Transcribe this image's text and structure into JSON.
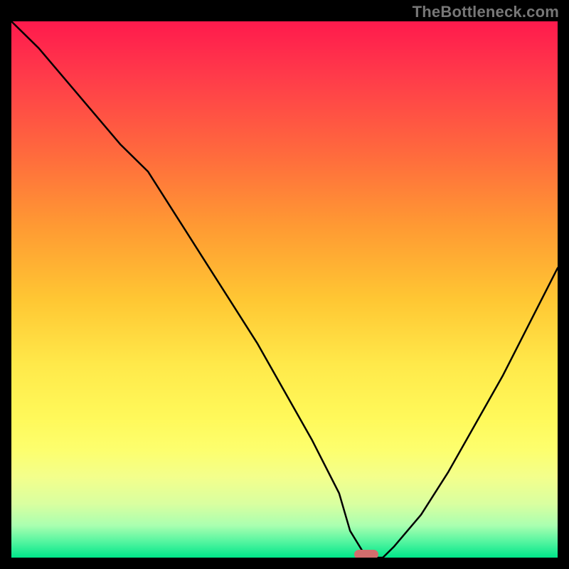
{
  "watermark": "TheBottleneck.com",
  "colors": {
    "background": "#000000",
    "curve": "#000000",
    "marker": "#d36d6d"
  },
  "chart_data": {
    "type": "line",
    "title": "",
    "xlabel": "",
    "ylabel": "",
    "xlim": [
      0,
      100
    ],
    "ylim": [
      0,
      100
    ],
    "grid": false,
    "legend": false,
    "annotations": [
      {
        "type": "marker",
        "x": 65,
        "y": 0,
        "shape": "pill"
      }
    ],
    "series": [
      {
        "name": "bottleneck-curve",
        "x": [
          0,
          5,
          10,
          15,
          20,
          25,
          30,
          35,
          40,
          45,
          50,
          55,
          60,
          62,
          65,
          68,
          70,
          75,
          80,
          85,
          90,
          95,
          100
        ],
        "y": [
          100,
          95,
          89,
          83,
          77,
          72,
          64,
          56,
          48,
          40,
          31,
          22,
          12,
          5,
          0,
          0,
          2,
          8,
          16,
          25,
          34,
          44,
          54
        ]
      }
    ],
    "background_gradient": {
      "orientation": "vertical",
      "note": "red (top, high bottleneck) -> yellow -> green (bottom, near-zero bottleneck)",
      "stops": [
        {
          "pos": 0.0,
          "color": "#ff1a4d"
        },
        {
          "pos": 0.25,
          "color": "#ff6b3d"
        },
        {
          "pos": 0.55,
          "color": "#ffe94a"
        },
        {
          "pos": 0.9,
          "color": "#d9ffa0"
        },
        {
          "pos": 1.0,
          "color": "#00e68a"
        }
      ]
    }
  }
}
